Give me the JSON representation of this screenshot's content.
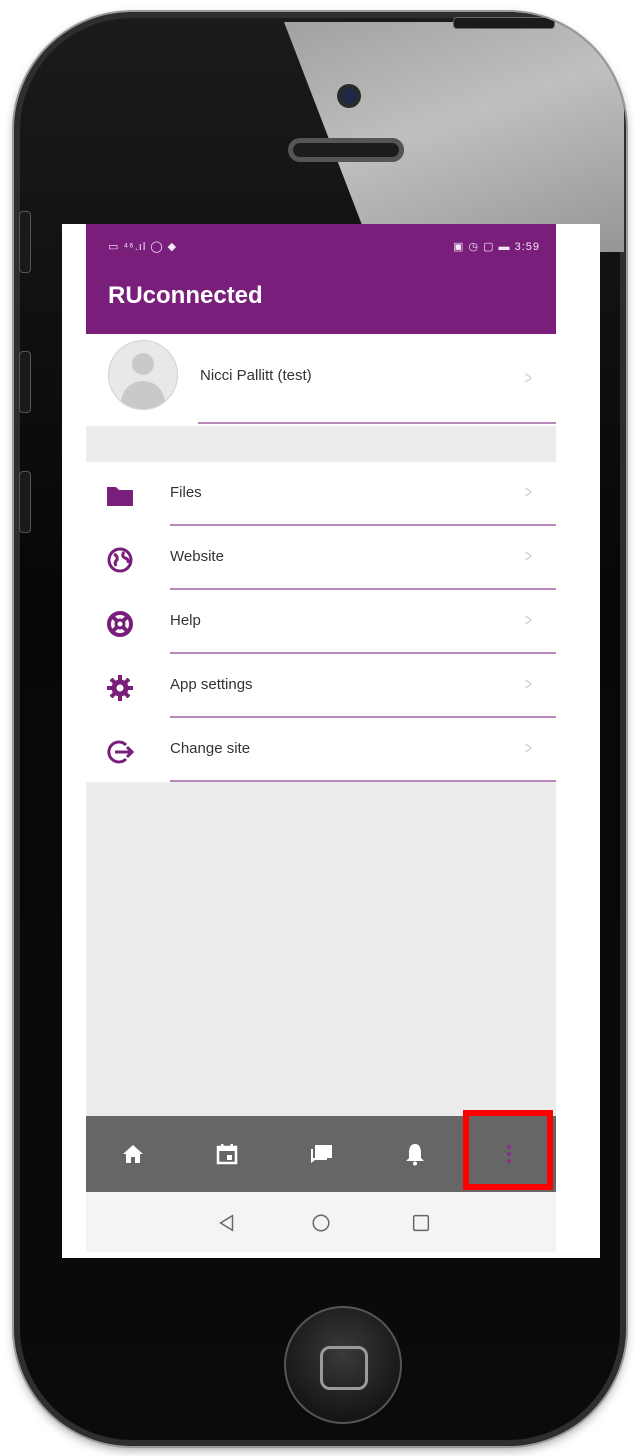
{
  "status_bar": {
    "left": "▭ ⁴⁶.ıl ◯ ◆",
    "right": "▣ ◷ ▢ ▬ 3:59"
  },
  "app": {
    "title": "RUconnected"
  },
  "profile": {
    "name": "Nicci Pallitt (test)"
  },
  "menu": {
    "items": [
      {
        "label": "Files",
        "icon": "folder-icon"
      },
      {
        "label": "Website",
        "icon": "globe-icon"
      },
      {
        "label": "Help",
        "icon": "lifebuoy-icon"
      },
      {
        "label": "App settings",
        "icon": "gear-icon"
      },
      {
        "label": "Change site",
        "icon": "logout-icon"
      }
    ]
  },
  "chevron": ">",
  "tabs": [
    {
      "name": "home",
      "icon": "home-icon"
    },
    {
      "name": "calendar",
      "icon": "calendar-icon"
    },
    {
      "name": "messages",
      "icon": "messages-icon"
    },
    {
      "name": "notifications",
      "icon": "bell-icon"
    },
    {
      "name": "more",
      "icon": "more-icon",
      "highlighted": true
    }
  ],
  "colors": {
    "brand": "#7a1e7c",
    "tabbar": "#666666",
    "highlight": "#ff0000"
  }
}
